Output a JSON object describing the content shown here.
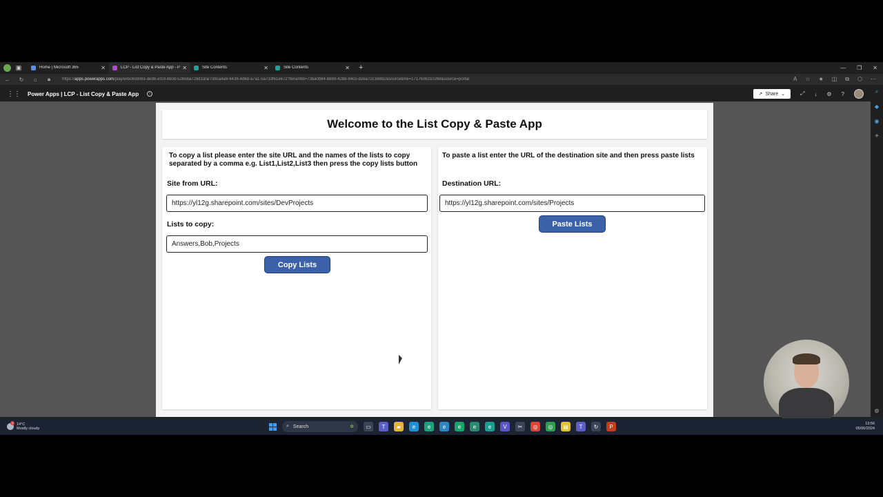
{
  "browser": {
    "tabs": [
      {
        "label": "Home | Microsoft 365",
        "favicon_color": "#5b8def",
        "active": false
      },
      {
        "label": "LCP - List Copy & Paste App - Po",
        "favicon_color": "#b04cc7",
        "active": true
      },
      {
        "label": "Site Contents",
        "favicon_color": "#1ba39c",
        "active": false
      },
      {
        "label": "Site Contents",
        "favicon_color": "#1ba39c",
        "active": false
      }
    ],
    "url_prefix": "https://",
    "url_host": "apps.powerapps.com",
    "url_rest": "/play/e/bc60d063-de98-ef19-890d-52b5ba728d1d/a/739ca4a9-6439-4d6d-a7a1-5a733f61e672?tenantId=73ba0b84-b889-42bb-84c5-d2ea72c168b2&sourcetime=1717606310268&source=portal"
  },
  "app_header": {
    "title": "Power Apps | LCP - List Copy & Paste App",
    "share_label": "Share"
  },
  "app": {
    "title": "Welcome to the List Copy & Paste App",
    "copy_panel": {
      "instructions": "To copy a list please enter the site URL and the names of the lists to copy separated by a comma e.g. List1,List2,List3 then press the copy lists button",
      "site_label": "Site from URL:",
      "site_value": "https://yl12g.sharepoint.com/sites/DevProjects",
      "lists_label": "Lists to copy:",
      "lists_value": "Answers,Bob,Projects",
      "button_label": "Copy Lists"
    },
    "paste_panel": {
      "instructions": "To paste a list enter the URL of the destination site and then press paste lists",
      "dest_label": "Destination URL:",
      "dest_value": "https://yl12g.sharepoint.com/sites/Projects",
      "button_label": "Paste Lists"
    }
  },
  "taskbar": {
    "weather_temp": "14°C",
    "weather_desc": "Mostly cloudy",
    "weather_badge": "1",
    "search_label": "Search",
    "time": "13:56",
    "date": "05/06/2024"
  },
  "colors": {
    "accent_button": "#3b62a8",
    "app_background": "#f3f3f3",
    "taskbar": "#1c2433"
  }
}
